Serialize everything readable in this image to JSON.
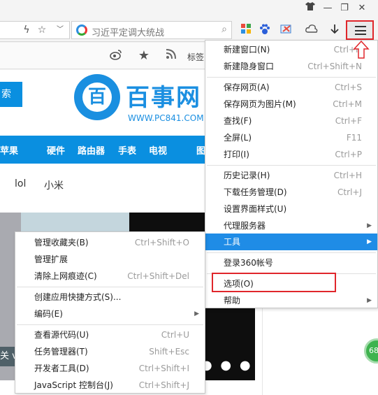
{
  "window": {
    "shirt_icon": "shirt-icon",
    "min_symbol": "—",
    "max_symbol": "❐",
    "close_symbol": "✕"
  },
  "toolbar": {
    "search_placeholder": "习近平定调大统战",
    "search_symbol": "⌕",
    "menu_icon": "hamburger-menu-icon"
  },
  "bookmarks": {
    "label": "标签"
  },
  "page": {
    "left_button_text": "索",
    "logo_glyph": "百",
    "logo_text": "百事网",
    "logo_url": "WWW.PC841.COM",
    "nav_items": [
      "苹果",
      "硬件",
      "路由器",
      "手表",
      "电视",
      "图"
    ],
    "sub_tags": [
      "lol",
      "小米"
    ],
    "hero_caption": "关 vi",
    "badge": "68"
  },
  "menu": {
    "items": [
      {
        "label": "新建窗口(N)",
        "shortcut": "Ctrl+N"
      },
      {
        "label": "新建隐身窗口",
        "shortcut": "Ctrl+Shift+N"
      },
      {
        "label": "保存网页(A)",
        "shortcut": "Ctrl+S"
      },
      {
        "label": "保存网页为图片(M)",
        "shortcut": "Ctrl+M"
      },
      {
        "label": "查找(F)",
        "shortcut": "Ctrl+F"
      },
      {
        "label": "全屏(L)",
        "shortcut": "F11"
      },
      {
        "label": "打印(I)",
        "shortcut": "Ctrl+P"
      },
      {
        "label": "历史记录(H)",
        "shortcut": "Ctrl+H"
      },
      {
        "label": "下载任务管理(D)",
        "shortcut": "Ctrl+J"
      },
      {
        "label": "设置界面样式(U)",
        "shortcut": ""
      },
      {
        "label": "代理服务器",
        "shortcut": ""
      },
      {
        "label": "工具",
        "shortcut": ""
      },
      {
        "label": "登录360帐号",
        "shortcut": ""
      },
      {
        "label": "选项(O)",
        "shortcut": ""
      },
      {
        "label": "帮助",
        "shortcut": ""
      }
    ]
  },
  "submenu": {
    "items": [
      {
        "label": "管理收藏夹(B)",
        "shortcut": "Ctrl+Shift+O"
      },
      {
        "label": "管理扩展",
        "shortcut": ""
      },
      {
        "label": "清除上网痕迹(C)",
        "shortcut": "Ctrl+Shift+Del"
      },
      {
        "label": "创建应用快捷方式(S)...",
        "shortcut": ""
      },
      {
        "label": "编码(E)",
        "shortcut": ""
      },
      {
        "label": "查看源代码(U)",
        "shortcut": "Ctrl+U"
      },
      {
        "label": "任务管理器(T)",
        "shortcut": "Shift+Esc"
      },
      {
        "label": "开发者工具(D)",
        "shortcut": "Ctrl+Shift+I"
      },
      {
        "label": "JavaScript 控制台(J)",
        "shortcut": "Ctrl+Shift+J"
      }
    ]
  },
  "colors": {
    "accent": "#1f8ce6",
    "highlight_box": "#e0262b",
    "site_blue": "#0a8fe0"
  }
}
